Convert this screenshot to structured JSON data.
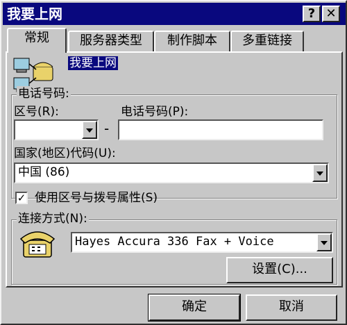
{
  "window": {
    "title": "我要上网"
  },
  "titlebar": {
    "help_label": "?",
    "close_label": "✕"
  },
  "tabs": [
    {
      "label": "常规",
      "active": true
    },
    {
      "label": "服务器类型",
      "active": false
    },
    {
      "label": "制作脚本",
      "active": false
    },
    {
      "label": "多重链接",
      "active": false
    }
  ],
  "general": {
    "connection_name": "我要上网",
    "phone_group_label": "电话号码:",
    "area_code_label": "区号(R):",
    "area_code_value": "",
    "phone_label": "电话号码(P):",
    "phone_value": "",
    "dash": "-",
    "country_label": "国家(地区)代码(U):",
    "country_value": "中国 (86)",
    "use_area_code_label": "使用区号与拨号属性(S)",
    "use_area_code_checked": true,
    "connect_using_label": "连接方式(N):",
    "modem_value": "Hayes Accura 336 Fax + Voice",
    "settings_button": "设置(C)..."
  },
  "footer": {
    "ok_button": "确定",
    "cancel_button": "取消"
  }
}
